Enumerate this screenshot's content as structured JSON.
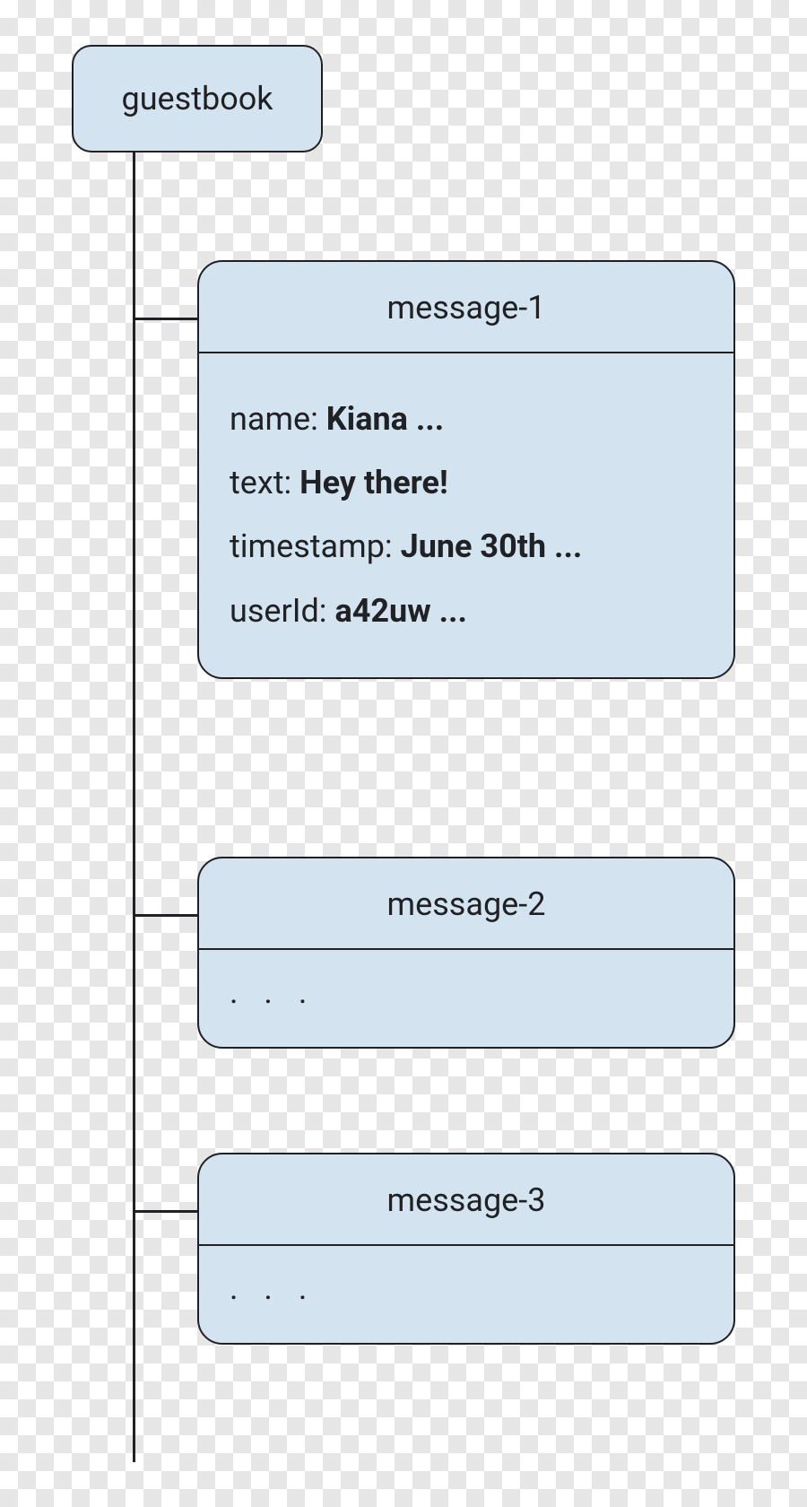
{
  "root": {
    "label": "guestbook"
  },
  "messages": [
    {
      "id_label": "message-1",
      "fields": [
        {
          "key": "name:",
          "value": "Kiana ..."
        },
        {
          "key": "text:",
          "value": "Hey there!"
        },
        {
          "key": "timestamp:",
          "value": "June 30th ..."
        },
        {
          "key": "userId:",
          "value": "a42uw ..."
        }
      ]
    },
    {
      "id_label": "message-2",
      "ellipsis": ". . ."
    },
    {
      "id_label": "message-3",
      "ellipsis": ". . ."
    }
  ]
}
